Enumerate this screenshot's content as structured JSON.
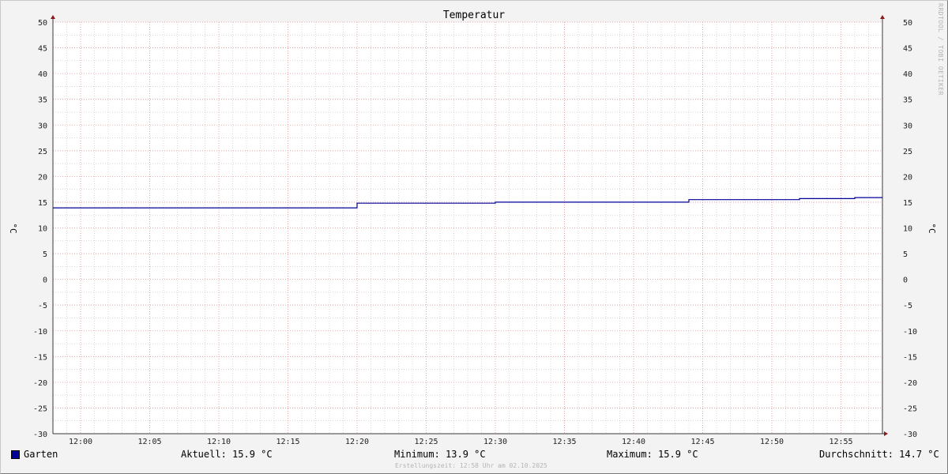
{
  "chart_data": {
    "type": "line",
    "title": "Temperatur",
    "ylabel": "°C",
    "ylabel_right": "°C",
    "ylim": [
      -30,
      50
    ],
    "y_ticks": [
      -30,
      -25,
      -20,
      -15,
      -10,
      -5,
      0,
      5,
      10,
      15,
      20,
      25,
      30,
      35,
      40,
      45,
      50
    ],
    "x_tick_labels": [
      "12:00",
      "12:05",
      "12:10",
      "12:15",
      "12:20",
      "12:25",
      "12:30",
      "12:35",
      "12:40",
      "12:45",
      "12:50",
      "12:55"
    ],
    "x_range": [
      "11:58",
      "12:58"
    ],
    "grid": true,
    "series": [
      {
        "name": "Garten",
        "color": "#000099",
        "points": [
          {
            "x": "11:58",
            "y": 13.9
          },
          {
            "x": "12:20",
            "y": 13.9
          },
          {
            "x": "12:20",
            "y": 14.8
          },
          {
            "x": "12:30",
            "y": 14.8
          },
          {
            "x": "12:30",
            "y": 15.0
          },
          {
            "x": "12:44",
            "y": 15.0
          },
          {
            "x": "12:44",
            "y": 15.5
          },
          {
            "x": "12:52",
            "y": 15.5
          },
          {
            "x": "12:52",
            "y": 15.7
          },
          {
            "x": "12:56",
            "y": 15.7
          },
          {
            "x": "12:56",
            "y": 15.9
          },
          {
            "x": "12:58",
            "y": 15.9
          }
        ]
      }
    ]
  },
  "legend": {
    "series_name": "Garten",
    "current": "Aktuell: 15.9 °C",
    "minimum": "Minimum: 13.9 °C",
    "maximum": "Maximum: 15.9 °C",
    "average": "Durchschnitt: 14.7 °C"
  },
  "footer": {
    "creation_time": "Erstellungszeit: 12:58 Uhr am 02.10.2025"
  },
  "watermark": "RRDTOOL / TOBI OETIKER",
  "colors": {
    "background": "#f3f3f3",
    "plot": "#ffffff",
    "series": "#000099",
    "major_grid": "#e69999",
    "minor_grid": "#bfbfbf"
  }
}
